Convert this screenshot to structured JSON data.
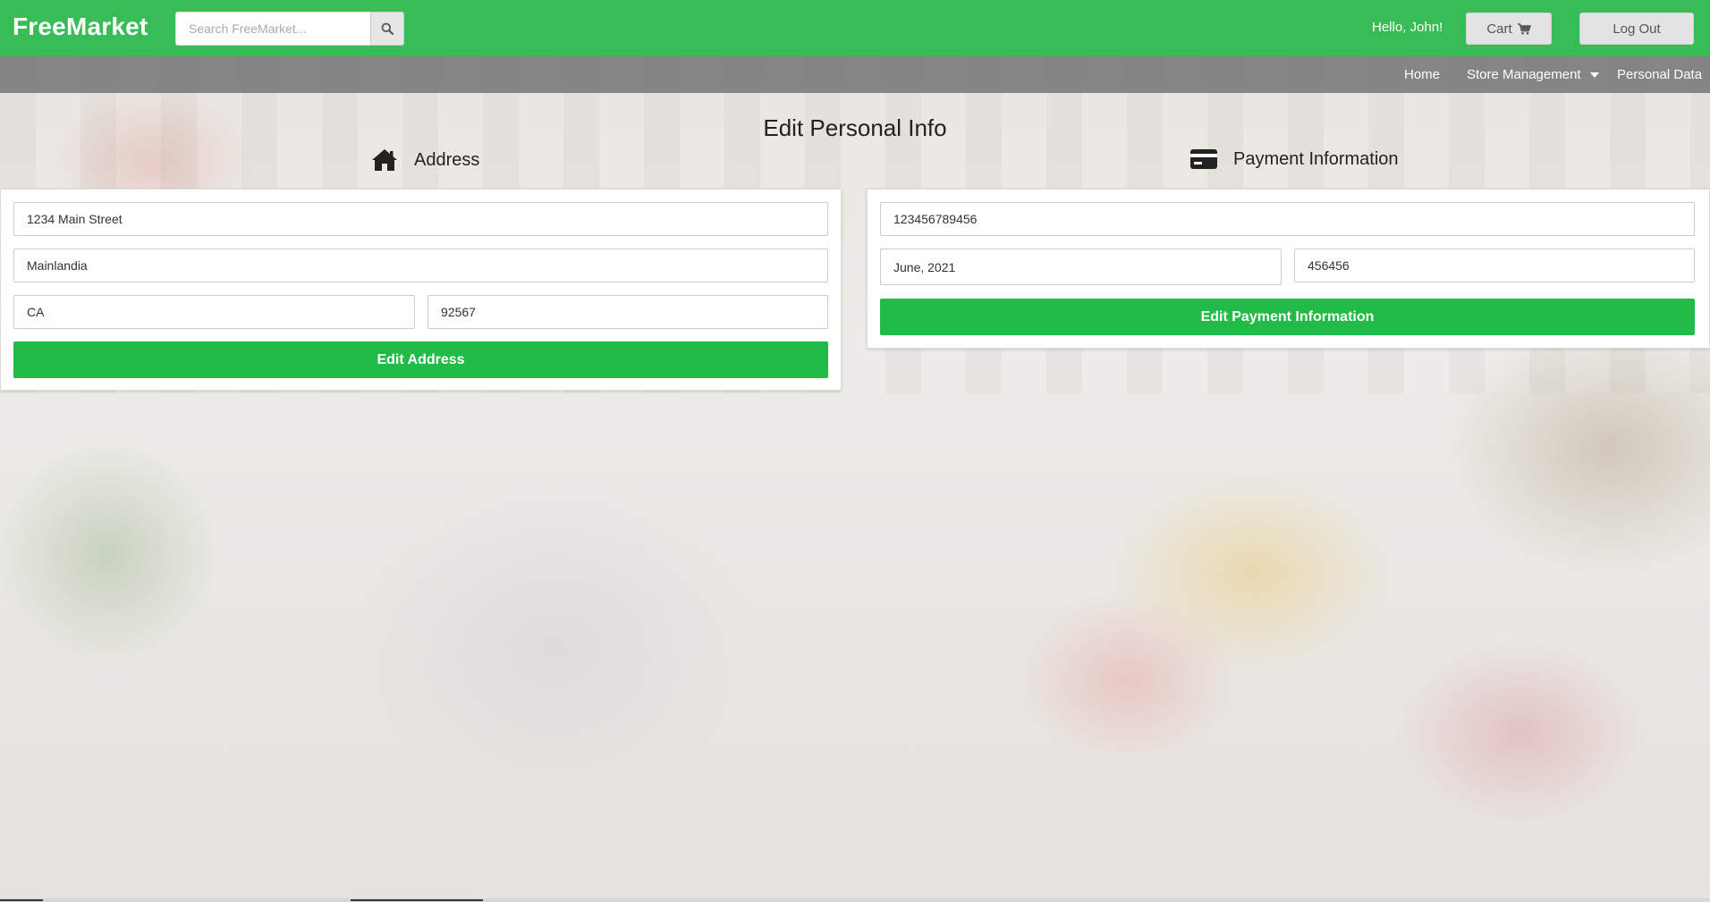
{
  "header": {
    "brand": "FreeMarket",
    "search_placeholder": "Search FreeMarket...",
    "greeting": "Hello, John!",
    "cart_label": "Cart",
    "logout_label": "Log Out",
    "brand_color": "#28b94b"
  },
  "subnav": {
    "home": "Home",
    "store_management": "Store Management",
    "personal_data": "Personal Data"
  },
  "page": {
    "title": "Edit Personal Info"
  },
  "address": {
    "heading": "Address",
    "street": "1234 Main Street",
    "city": "Mainlandia",
    "state": "CA",
    "zip": "92567",
    "submit_label": "Edit Address"
  },
  "payment": {
    "heading": "Payment Information",
    "card_number": "123456789456",
    "expiration": "June, 2021",
    "cvv": "456456",
    "submit_label": "Edit Payment Information"
  },
  "icons": {
    "search": "search-icon",
    "cart": "cart-icon",
    "home": "home-icon",
    "card": "credit-card-icon"
  }
}
